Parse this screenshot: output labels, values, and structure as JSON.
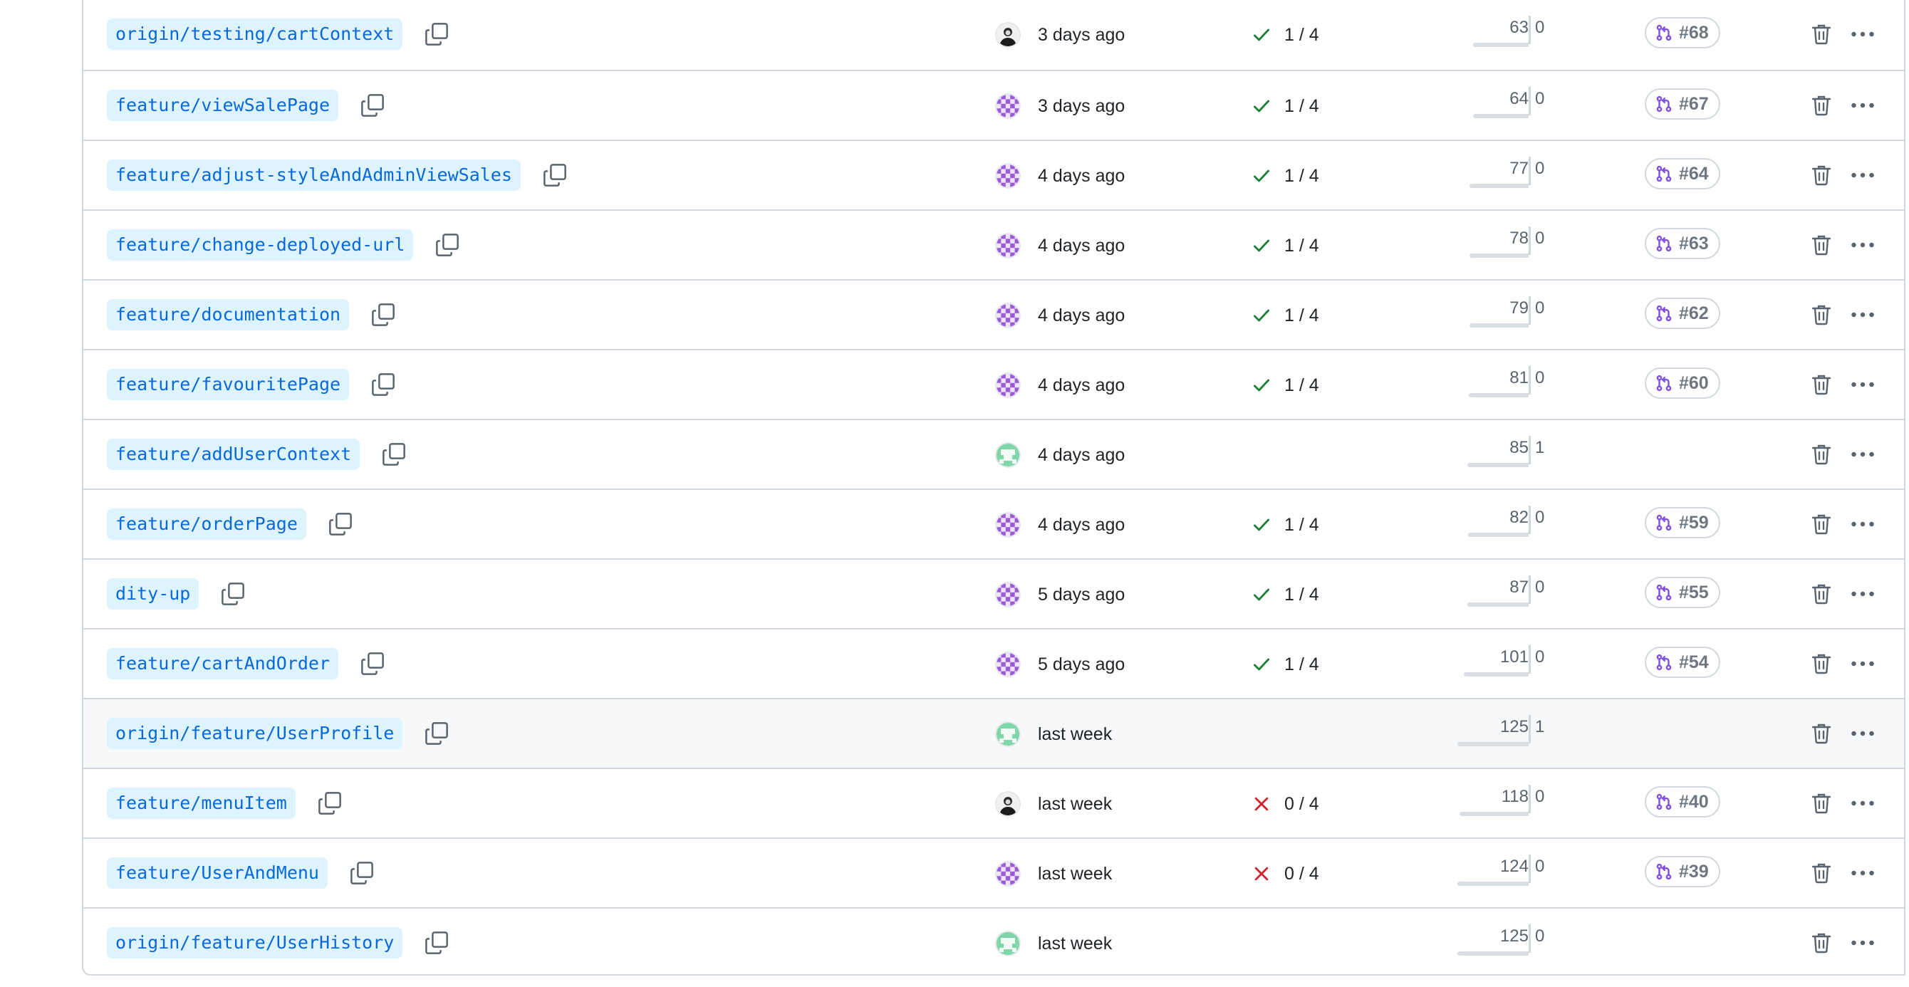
{
  "colors": {
    "branch_bg": "#ddf4ff",
    "branch_text": "#0969da",
    "check_success": "#1a7f37",
    "check_fail": "#cf222e",
    "pr_open": "#8250df",
    "border": "#d0d7de"
  },
  "rows": [
    {
      "branch": "origin/testing/cartContext",
      "avatar": "dark",
      "updated": "3 days ago",
      "checks": "1 / 4",
      "status": "success",
      "behind": "63",
      "ahead": "0",
      "pr": "#68"
    },
    {
      "branch": "feature/viewSalePage",
      "avatar": "purple",
      "updated": "3 days ago",
      "checks": "1 / 4",
      "status": "success",
      "behind": "64",
      "ahead": "0",
      "pr": "#67"
    },
    {
      "branch": "feature/adjust-styleAndAdminViewSales",
      "avatar": "purple",
      "updated": "4 days ago",
      "checks": "1 / 4",
      "status": "success",
      "behind": "77",
      "ahead": "0",
      "pr": "#64"
    },
    {
      "branch": "feature/change-deployed-url",
      "avatar": "purple",
      "updated": "4 days ago",
      "checks": "1 / 4",
      "status": "success",
      "behind": "78",
      "ahead": "0",
      "pr": "#63"
    },
    {
      "branch": "feature/documentation",
      "avatar": "purple",
      "updated": "4 days ago",
      "checks": "1 / 4",
      "status": "success",
      "behind": "79",
      "ahead": "0",
      "pr": "#62"
    },
    {
      "branch": "feature/favouritePage",
      "avatar": "purple",
      "updated": "4 days ago",
      "checks": "1 / 4",
      "status": "success",
      "behind": "81",
      "ahead": "0",
      "pr": "#60"
    },
    {
      "branch": "feature/addUserContext",
      "avatar": "green",
      "updated": "4 days ago",
      "checks": "",
      "status": "none",
      "behind": "85",
      "ahead": "1",
      "pr": ""
    },
    {
      "branch": "feature/orderPage",
      "avatar": "purple",
      "updated": "4 days ago",
      "checks": "1 / 4",
      "status": "success",
      "behind": "82",
      "ahead": "0",
      "pr": "#59"
    },
    {
      "branch": "dity-up",
      "avatar": "purple",
      "updated": "5 days ago",
      "checks": "1 / 4",
      "status": "success",
      "behind": "87",
      "ahead": "0",
      "pr": "#55"
    },
    {
      "branch": "feature/cartAndOrder",
      "avatar": "purple",
      "updated": "5 days ago",
      "checks": "1 / 4",
      "status": "success",
      "behind": "101",
      "ahead": "0",
      "pr": "#54"
    },
    {
      "branch": "origin/feature/UserProfile",
      "avatar": "green",
      "updated": "last week",
      "checks": "",
      "status": "none",
      "behind": "125",
      "ahead": "1",
      "pr": ""
    },
    {
      "branch": "feature/menuItem",
      "avatar": "dark",
      "updated": "last week",
      "checks": "0 / 4",
      "status": "fail",
      "behind": "118",
      "ahead": "0",
      "pr": "#40"
    },
    {
      "branch": "feature/UserAndMenu",
      "avatar": "purple",
      "updated": "last week",
      "checks": "0 / 4",
      "status": "fail",
      "behind": "124",
      "ahead": "0",
      "pr": "#39"
    },
    {
      "branch": "origin/feature/UserHistory",
      "avatar": "green",
      "updated": "last week",
      "checks": "",
      "status": "none",
      "behind": "125",
      "ahead": "0",
      "pr": ""
    }
  ],
  "icons": {
    "copy": "copy-icon",
    "trash": "trash-icon",
    "more": "kebab-horizontal-icon",
    "pr": "git-pull-request-icon",
    "check": "check-icon",
    "fail": "x-icon"
  }
}
